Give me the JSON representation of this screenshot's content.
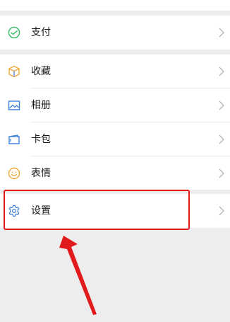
{
  "menu": {
    "pay": {
      "label": "支付",
      "icon": "wechat-pay-icon"
    },
    "favorites": {
      "label": "收藏",
      "icon": "cube-icon"
    },
    "album": {
      "label": "相册",
      "icon": "picture-icon"
    },
    "cards": {
      "label": "卡包",
      "icon": "card-wallet-icon"
    },
    "stickers": {
      "label": "表情",
      "icon": "smiley-icon"
    },
    "settings": {
      "label": "设置",
      "icon": "gear-icon"
    }
  },
  "annotation": {
    "highlight_color": "#e11b1b",
    "arrow_color": "#e11b1b"
  },
  "colors": {
    "background": "#ededed",
    "pay_icon": "#3fbf6b",
    "favorites_icon_a": "#f2a93b",
    "favorites_icon_b": "#5b8fe0",
    "album_icon": "#3f7fd8",
    "cards_icon": "#3f7fd8",
    "stickers_icon": "#f0a93b",
    "settings_icon": "#3f7fd8"
  }
}
